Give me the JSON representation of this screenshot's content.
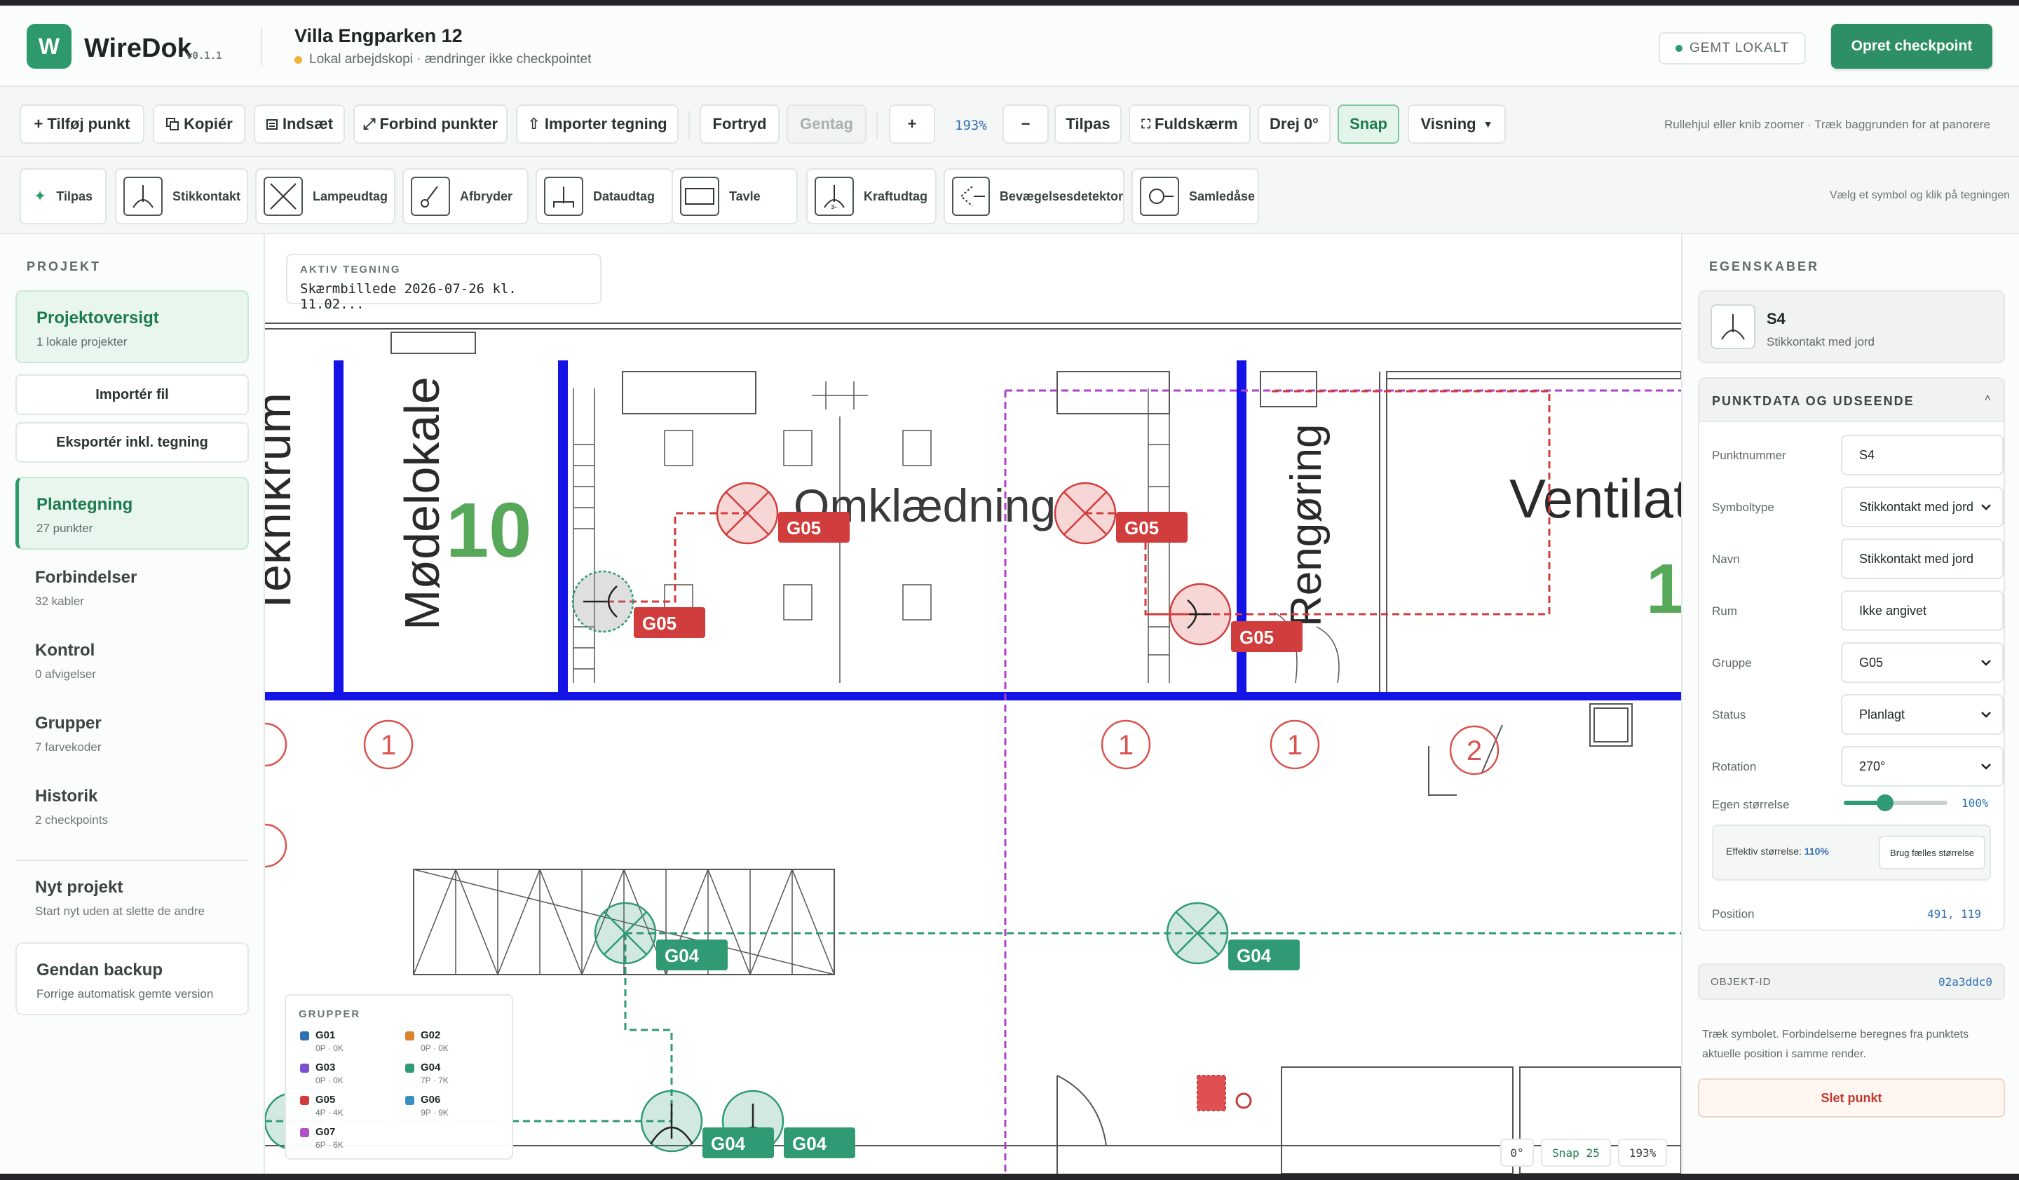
{
  "app": {
    "logo_letter": "W",
    "name": "WireDok",
    "version": "v0.1.1"
  },
  "project": {
    "title": "Villa Engparken 12",
    "subtitle": "Lokal arbejdskopi · ændringer ikke checkpointet"
  },
  "header": {
    "saved_label": "GEMT LOKALT",
    "primary_label": "Opret checkpoint"
  },
  "toolbar": {
    "add_point": "+ Tilføj punkt",
    "copy": "Kopiér",
    "paste": "Indsæt",
    "connect": "Forbind punkter",
    "import_drawing": "Importer tegning",
    "undo": "Fortryd",
    "redo": "Gentag",
    "zoom_in": "+",
    "zoom_level": "193%",
    "zoom_out": "−",
    "fit": "Tilpas",
    "fullscreen": "Fuldskærm",
    "rotate": "Drej 0°",
    "snap": "Snap",
    "view": "Visning",
    "hint": "Rullehjul eller knib zoomer · Træk baggrunden for at panorere"
  },
  "symbols": {
    "fit_label": "Tilpas",
    "items": [
      "Stikkontakt",
      "Lampeudtag",
      "Afbryder",
      "Dataudtag",
      "Tavle",
      "Kraftudtag",
      "Bevægelsesdetektor",
      "Samledåse"
    ],
    "hint": "Vælg et symbol og klik på tegningen"
  },
  "sidebar": {
    "section_label": "PROJEKT",
    "overview": {
      "title": "Projektoversigt",
      "sub": "1 lokale projekter"
    },
    "import_file": "Importér fil",
    "export": "Eksportér inkl. tegning",
    "items": [
      {
        "title": "Plantegning",
        "sub": "27 punkter"
      },
      {
        "title": "Forbindelser",
        "sub": "32 kabler"
      },
      {
        "title": "Kontrol",
        "sub": "0 afvigelser"
      },
      {
        "title": "Grupper",
        "sub": "7 farvekoder"
      },
      {
        "title": "Historik",
        "sub": "2 checkpoints"
      }
    ],
    "new_project": {
      "title": "Nyt projekt",
      "sub": "Start nyt uden at slette de andre"
    },
    "restore": {
      "title": "Gendan backup",
      "sub": "Forrige automatisk gemte version"
    }
  },
  "canvas": {
    "active_label": "AKTIV TEGNING",
    "active_value": "Skærmbillede 2026-07-26 kl. 11.02...",
    "room_labels": [
      "Teknikrum",
      "Mødelokale",
      "10",
      "Omklædning",
      "Rengøring",
      "Ventilat",
      "1"
    ],
    "circle_numbers": [
      "1",
      "1",
      "1",
      "2"
    ],
    "point_labels": [
      "G05",
      "G05",
      "G05",
      "G05",
      "G04",
      "G04",
      "G04",
      "G04"
    ],
    "groups_title": "GRUPPER",
    "groups": [
      {
        "name": "G01",
        "count": "0P · 0K",
        "color": "#2f6fb3"
      },
      {
        "name": "G02",
        "count": "0P · 0K",
        "color": "#d9822b"
      },
      {
        "name": "G03",
        "count": "0P · 0K",
        "color": "#7a4fd0"
      },
      {
        "name": "G04",
        "count": "7P · 7K",
        "color": "#2f9a73"
      },
      {
        "name": "G05",
        "count": "4P · 4K",
        "color": "#d13c3c"
      },
      {
        "name": "G06",
        "count": "9P · 9K",
        "color": "#3a8fc2"
      },
      {
        "name": "G07",
        "count": "6P · 6K",
        "color": "#b04fc9"
      }
    ],
    "status_rotation": "0°",
    "status_snap": "Snap 25",
    "status_zoom": "193%"
  },
  "properties": {
    "section_label": "EGENSKABER",
    "selected_id": "S4",
    "selected_type": "Stikkontakt med jord",
    "panel_title": "PUNKTDATA OG UDSEENDE",
    "fields": {
      "number_label": "Punktnummer",
      "number_value": "S4",
      "symbol_label": "Symboltype",
      "symbol_value": "Stikkontakt med jord",
      "name_label": "Navn",
      "name_value": "Stikkontakt med jord",
      "room_label": "Rum",
      "room_value": "Ikke angivet",
      "group_label": "Gruppe",
      "group_value": "G05",
      "status_label": "Status",
      "status_value": "Planlagt",
      "rotation_label": "Rotation",
      "rotation_value": "270°",
      "size_label": "Egen størrelse",
      "size_value": "100%",
      "size_fraction": 0.4
    },
    "effective_label": "Effektiv størrelse:",
    "effective_value": "110%",
    "common_size_btn": "Brug fælles størrelse",
    "position_label": "Position",
    "position_value": "491, 119",
    "object_id_label": "OBJEKT-ID",
    "object_id_value": "02a3ddc0",
    "help": "Træk symbolet. Forbindelserne beregnes fra punktets aktuelle position i samme render.",
    "delete": "Slet punkt"
  }
}
